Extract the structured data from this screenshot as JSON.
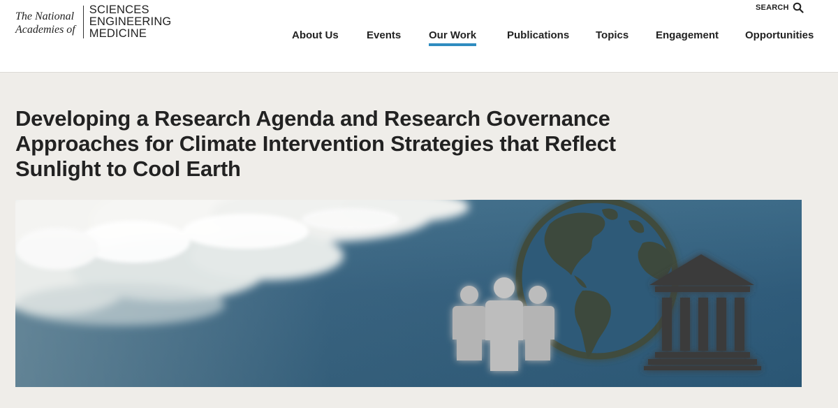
{
  "logo": {
    "left_line1": "The National",
    "left_line2": "Academies of",
    "right_line1": "SCIENCES",
    "right_line2": "ENGINEERING",
    "right_line3": "MEDICINE"
  },
  "search": {
    "label": "SEARCH",
    "icon": "search-icon"
  },
  "nav": {
    "items": [
      {
        "label": "About Us",
        "active": false
      },
      {
        "label": "Events",
        "active": false
      },
      {
        "label": "Our Work",
        "active": true
      },
      {
        "label": "Publications",
        "active": false
      },
      {
        "label": "Topics",
        "active": false
      },
      {
        "label": "Engagement",
        "active": false
      },
      {
        "label": "Opportunities",
        "active": false
      }
    ],
    "active_color": "#2f8cc0"
  },
  "page": {
    "title_line1": "Developing a Research Agenda and Research Governance",
    "title_line2": "Approaches for Climate Intervention Strategies that Reflect",
    "title_line3": "Sunlight to Cool Earth"
  },
  "hero": {
    "icons": [
      "cloud-icon",
      "globe-icon",
      "people-icon",
      "government-building-icon"
    ],
    "colors": {
      "sky": "#2e5a78",
      "globe": "#3c4a3c",
      "people": "#b8b8b8",
      "building": "#3a3a3a"
    }
  }
}
